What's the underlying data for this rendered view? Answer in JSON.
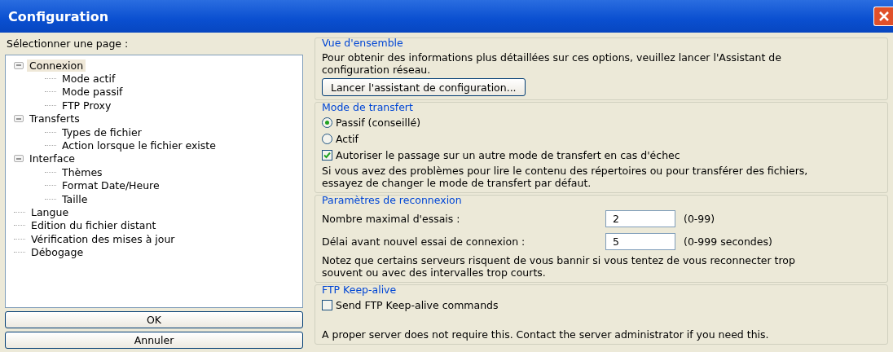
{
  "window": {
    "title": "Configuration"
  },
  "sidebar": {
    "label": "Sélectionner une page :",
    "tree": [
      {
        "label": "Connexion",
        "selected": true,
        "expanded": true,
        "children": [
          {
            "label": "Mode actif",
            "selected": false
          },
          {
            "label": "Mode passif",
            "selected": false
          },
          {
            "label": "FTP Proxy",
            "selected": false
          }
        ]
      },
      {
        "label": "Transferts",
        "selected": false,
        "expanded": true,
        "children": [
          {
            "label": "Types de fichier",
            "selected": false
          },
          {
            "label": "Action lorsque le fichier existe",
            "selected": false
          }
        ]
      },
      {
        "label": "Interface",
        "selected": false,
        "expanded": true,
        "children": [
          {
            "label": "Thèmes",
            "selected": false
          },
          {
            "label": "Format Date/Heure",
            "selected": false
          },
          {
            "label": "Taille",
            "selected": false
          }
        ]
      },
      {
        "label": "Langue",
        "selected": false
      },
      {
        "label": "Edition du fichier distant",
        "selected": false
      },
      {
        "label": "Vérification des mises à jour",
        "selected": false
      },
      {
        "label": "Débogage",
        "selected": false
      }
    ],
    "buttons": [
      "OK",
      "Annuler"
    ]
  },
  "groups": [
    {
      "title": "Vue d'ensemble",
      "items": [
        {
          "kind": "text",
          "text": "Pour obtenir des informations plus détaillées sur ces options, veuillez lancer l'Assistant de configuration réseau."
        },
        {
          "kind": "button",
          "label": "Lancer l'assistant de configuration..."
        }
      ]
    },
    {
      "title": "Mode de transfert",
      "items": [
        {
          "kind": "radio",
          "label": "Passif (conseillé)",
          "selected": true
        },
        {
          "kind": "radio",
          "label": "Actif",
          "selected": false
        },
        {
          "kind": "checkbox",
          "label": "Autoriser le passage sur un autre mode de transfert en cas d'échec",
          "checked": true
        },
        {
          "kind": "text",
          "text": "Si vous avez des problèmes pour lire le contenu des répertoires ou pour transférer des fichiers, essayez de changer le mode de transfert par défaut."
        }
      ]
    },
    {
      "title": "Paramètres de reconnexion",
      "items": [
        {
          "kind": "field",
          "label": "Nombre maximal d'essais :",
          "value": "2",
          "hint": "(0-99)"
        },
        {
          "kind": "field",
          "label": "Délai avant nouvel essai de connexion :",
          "value": "5",
          "hint": "(0-999 secondes)"
        },
        {
          "kind": "text",
          "text": "Notez que certains serveurs risquent de vous bannir si vous tentez de vous reconnecter trop souvent ou avec des intervalles trop courts."
        }
      ]
    },
    {
      "title": "FTP Keep-alive",
      "items": [
        {
          "kind": "checkbox",
          "label": "Send FTP Keep-alive commands",
          "checked": false
        },
        {
          "kind": "spacer"
        },
        {
          "kind": "text",
          "text": "A proper server does not require this. Contact the server administrator if you need this."
        }
      ]
    }
  ]
}
